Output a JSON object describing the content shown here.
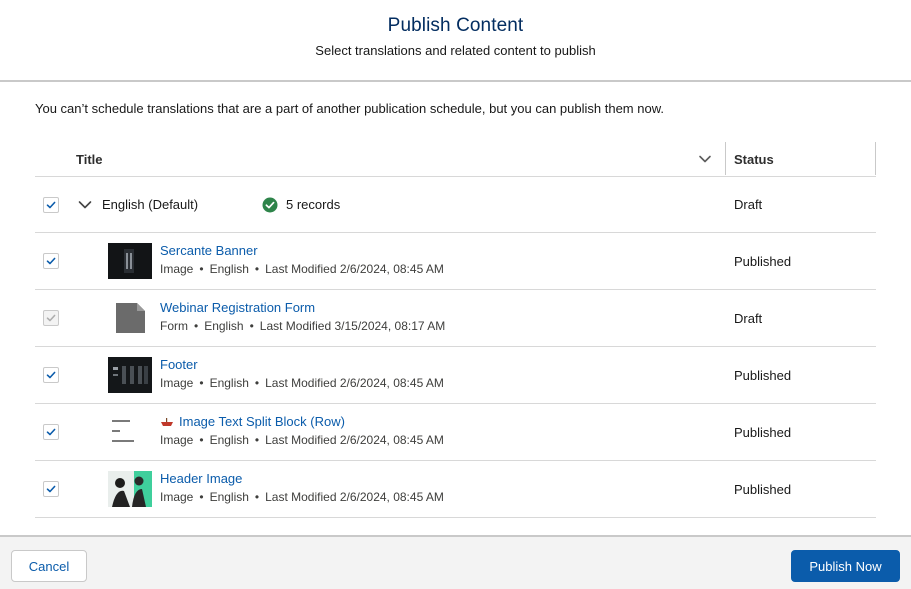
{
  "header": {
    "title": "Publish Content",
    "subtitle": "Select translations and related content to publish"
  },
  "notice": "You can’t schedule translations that are a part of another publication schedule, but you can publish them now.",
  "table": {
    "col_title": "Title",
    "col_status": "Status"
  },
  "group": {
    "label": "English (Default)",
    "count": "5 records",
    "status": "Draft",
    "checked": true
  },
  "items": [
    {
      "name": "Sercante Banner",
      "type": "Image",
      "lang": "English",
      "modified": "Last Modified 2/6/2024, 08:45 AM",
      "status": "Published",
      "thumb": "banner"
    },
    {
      "name": "Webinar Registration Form",
      "type": "Form",
      "lang": "English",
      "modified": "Last Modified 3/15/2024, 08:17 AM",
      "status": "Draft",
      "thumb": "form-file-icon"
    },
    {
      "name": "Footer",
      "type": "Image",
      "lang": "English",
      "modified": "Last Modified 2/6/2024, 08:45 AM",
      "status": "Published",
      "thumb": "footer"
    },
    {
      "name": "Image Text Split Block (Row)",
      "type": "Image",
      "lang": "English",
      "modified": "Last Modified 2/6/2024, 08:45 AM",
      "status": "Published",
      "thumb": "split"
    },
    {
      "name": "Header Image",
      "type": "Image",
      "lang": "English",
      "modified": "Last Modified 2/6/2024, 08:45 AM",
      "status": "Published",
      "thumb": "header"
    }
  ],
  "footer": {
    "cancel_label": "Cancel",
    "publish_label": "Publish Now"
  },
  "colors": {
    "brand_blue": "#0b5cab",
    "title_navy": "#032d60",
    "success_green": "#2e844a"
  }
}
